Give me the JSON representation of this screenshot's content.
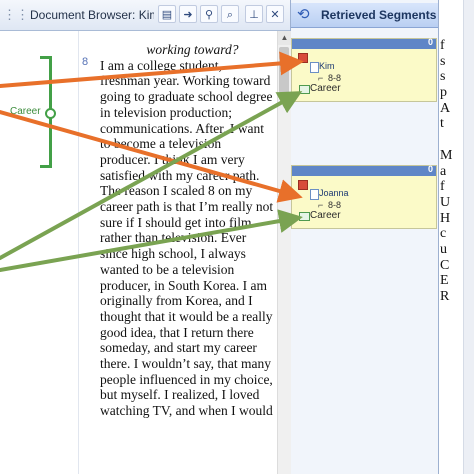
{
  "document_browser": {
    "title": "Document Browser: Kim",
    "grip_icon": "grip-icon",
    "buttons": [
      {
        "name": "document-icon-button",
        "glyph": "▤"
      },
      {
        "name": "export-icon-button",
        "glyph": "➜"
      },
      {
        "name": "filter-icon-button",
        "glyph": "⚲"
      },
      {
        "name": "search-icon-button",
        "glyph": "⌕"
      },
      {
        "name": "pin-icon-button",
        "glyph": "⊥"
      },
      {
        "name": "close-icon-button",
        "glyph": "✕"
      }
    ],
    "line_number": "8",
    "heading_line": "working toward?",
    "paragraph": "I am a college student, freshman year. Working toward going to graduate school degree in television production; communications. After, I want to become a television producer. I think I am very satisfied with my career path. The reason I scaled 8 on my career path is that I’m really not sure if I should get into film rather than television. Ever since high school, I always wanted to be a television producer, in South Korea. I am originally from Korea, and I thought that it would be a really good idea, that I return there someday, and start my career there. I wouldn’t say, that many people influenced in my choice, but myself. I realized, I loved watching TV, and when I would",
    "code_label": "Career",
    "scroll_up_glyph": "▲"
  },
  "retrieved_segments": {
    "title": "Retrieved Segments",
    "icon": "retrieved-segments-icon",
    "cards": [
      {
        "count": "0",
        "document": "Kim",
        "range_glyph": "⌐",
        "range": "8-8",
        "code": "Career"
      },
      {
        "count": "0",
        "document": "Joanna",
        "range_glyph": "⌐",
        "range": "8-8",
        "code": "Career"
      }
    ]
  },
  "right_panel": {
    "lines": [
      "f",
      "s",
      "s",
      "p",
      "A",
      "t",
      "",
      "M",
      "a",
      "f",
      "U",
      "H",
      "c",
      "u",
      "C",
      "E",
      "R"
    ]
  },
  "colors": {
    "arrow_orange": "#e8702a",
    "arrow_green": "#7aa352",
    "bracket_green": "#43a047",
    "segment_header_blue": "#5f86c7",
    "segment_card_yellow": "#fbfac8"
  }
}
